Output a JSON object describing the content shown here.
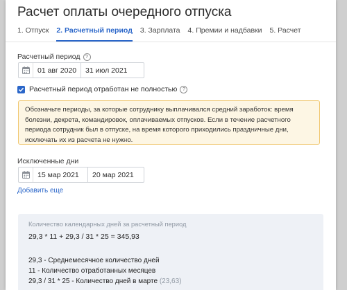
{
  "dialog": {
    "title": "Расчет оплаты очередного отпуска"
  },
  "tabs": [
    {
      "label": "1. Отпуск",
      "active": false
    },
    {
      "label": "2. Расчетный период",
      "active": true
    },
    {
      "label": "3. Зарплата",
      "active": false
    },
    {
      "label": "4. Премии и надбавки",
      "active": false
    },
    {
      "label": "5. Расчет",
      "active": false
    }
  ],
  "period": {
    "label": "Расчетный период",
    "help": "?",
    "from": "01 авг 2020",
    "to": "31 июл 2021"
  },
  "partial": {
    "checked": true,
    "label": "Расчетный период отработан не полностью",
    "help": "?"
  },
  "note": {
    "text": "Обозначьте периоды, за которые сотруднику выплачивался средний заработок: время болезни, декрета, командировок, оплачиваемых отпусков. Если в течение расчетного периода сотрудник был в отпуске, на время которого приходились праздничные дни, исключать их из расчета не нужно."
  },
  "excluded": {
    "label": "Исключенные дни",
    "from": "15 мар 2021",
    "to": "20 мар 2021",
    "add_link": "Добавить еще"
  },
  "calc": {
    "header": "Количество календарных дней за расчетный период",
    "formula": "29,3 * 11 + 29,3 / 31 * 25 = 345,93",
    "lines": [
      {
        "text": "29,3 - Среднемесячное количество дней",
        "extra": ""
      },
      {
        "text": "11 - Количество отработанных месяцев",
        "extra": ""
      },
      {
        "text": "29,3 / 31 * 25 - Количество дней в марте",
        "extra": "(23,63)"
      }
    ]
  },
  "colors": {
    "accent": "#2a66c9",
    "note_bg": "#fdf6e4",
    "note_border": "#f0c66e",
    "calc_bg": "#eef1f6"
  }
}
